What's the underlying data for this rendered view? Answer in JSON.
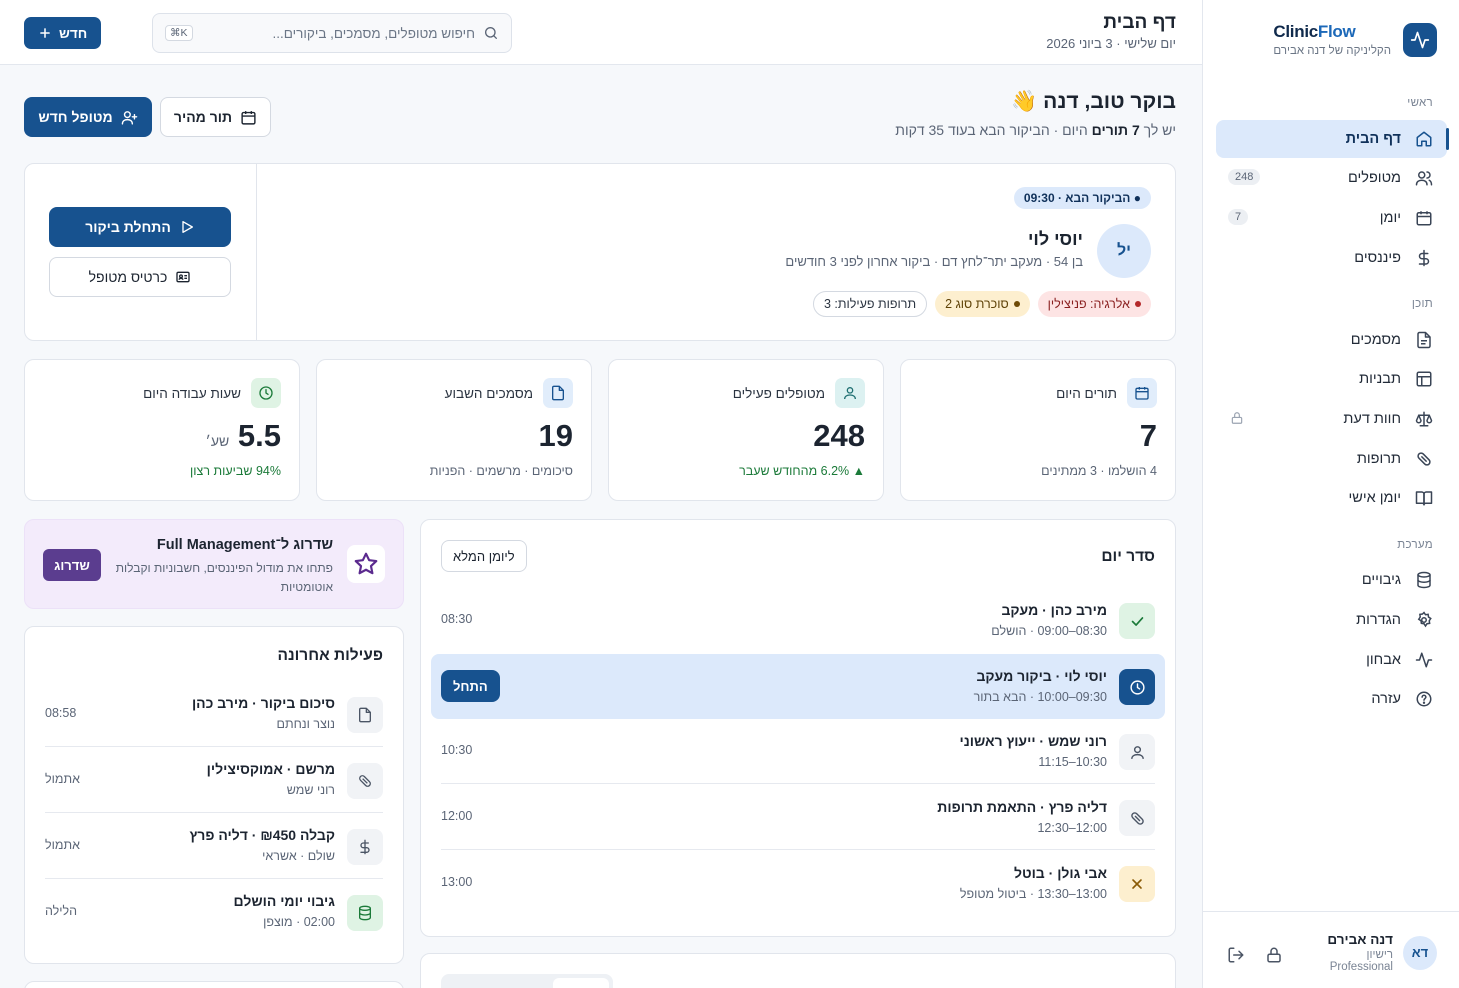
{
  "brand": {
    "name_a": "Clinic",
    "name_b": "Flow",
    "subtitle": "הקליניקה של דנה אבירם"
  },
  "sidebar": {
    "sections": [
      "ראשי",
      "תוכן",
      "מערכת"
    ],
    "items": [
      {
        "label": "דף הבית",
        "icon": "home-icon",
        "active": true
      },
      {
        "label": "מטופלים",
        "icon": "users-icon",
        "count": "248"
      },
      {
        "label": "יומן",
        "icon": "calendar-icon",
        "count": "7"
      },
      {
        "label": "פיננסים",
        "icon": "dollar-icon"
      },
      {
        "label": "מסמכים",
        "icon": "document-icon"
      },
      {
        "label": "תבניות",
        "icon": "template-icon"
      },
      {
        "label": "חוות דעת",
        "icon": "scale-icon",
        "locked": true
      },
      {
        "label": "תרופות",
        "icon": "pill-icon"
      },
      {
        "label": "יומן אישי",
        "icon": "book-icon"
      },
      {
        "label": "גיבויים",
        "icon": "database-icon"
      },
      {
        "label": "הגדרות",
        "icon": "gear-icon"
      },
      {
        "label": "אבחון",
        "icon": "activity-icon"
      },
      {
        "label": "עזרה",
        "icon": "help-icon"
      }
    ]
  },
  "user": {
    "initials": "דא",
    "name": "דנה אבירם",
    "role": "רישיון",
    "plan": "Professional"
  },
  "header": {
    "title": "דף הבית",
    "date": "יום שלישי · 3 ביוני 2026",
    "search_placeholder": "חיפוש מטופלים, מסמכים, ביקורים...",
    "search_kbd": "⌘K",
    "new_label": "חדש"
  },
  "greeting": {
    "title": "בוקר טוב, דנה 👋",
    "sub_a": "יש לך ",
    "sub_bold": "7 תורים",
    "sub_b": " היום · הביקור הבא בעוד 35 דקות",
    "new_patient": "מטופל חדש",
    "quick_appointment": "תור מהיר"
  },
  "next_patient": {
    "badge": "הביקור הבא · 09:30",
    "initials": "יל",
    "name": "יוסי לוי",
    "info": "בן 54 · מעקב יתר־לחץ דם · ביקור אחרון לפני 3 חודשים",
    "tags": [
      "אלרגיה: פניצילין",
      "סוכרת סוג 2",
      "תרופות פעילות: 3"
    ],
    "start_visit": "התחלת ביקור",
    "patient_file": "כרטיס מטופל"
  },
  "stats": [
    {
      "label": "תורים היום",
      "value": "7",
      "unit": "",
      "foot": "4 הושלמו · 3 ממתינים",
      "icon": "calendar-icon",
      "color": "#e1edfb",
      "ink": "#17528f"
    },
    {
      "label": "מטופלים פעילים",
      "value": "248",
      "unit": "",
      "foot": "▲ 6.2% מהחודש שעבר",
      "icon": "user-icon",
      "color": "#dcf1f1",
      "ink": "#1d6e70"
    },
    {
      "label": "מסמכים השבוע",
      "value": "19",
      "unit": "",
      "foot": "סיכומים · מרשמים · הפניות",
      "icon": "document-icon",
      "color": "#e1edfb",
      "ink": "#17528f"
    },
    {
      "label": "שעות עבודה היום",
      "value": "5.5",
      "unit": "שע׳",
      "foot": "94% שביעות רצון",
      "icon": "clock-icon",
      "color": "#dff3e4",
      "ink": "#1b7a39"
    }
  ],
  "upgrade": {
    "title": "שדרוג ל־Full Management",
    "desc": "פתחו את מודול הפיננסים, חשבוניות וקבלות אוטומטיות",
    "button": "שדרוג"
  },
  "schedule": {
    "title": "סדר יום",
    "full_button": "ליומן המלא",
    "start_label": "התחל",
    "rows": [
      {
        "main": "מירב כהן · מעקב",
        "sub": "08:30–09:00 · הושלם",
        "time": "08:30",
        "icon": "check-icon"
      },
      {
        "main": "יוסי לוי · ביקור מעקב",
        "sub": "09:30–10:00 · הבא בתור",
        "time": "",
        "icon": "clock-icon"
      },
      {
        "main": "רוני שמש · ייעוץ ראשוני",
        "sub": "10:30–11:15",
        "time": "10:30",
        "icon": "user-icon"
      },
      {
        "main": "דליה פרץ · התאמת תרופות",
        "sub": "12:00–12:30",
        "time": "12:00",
        "icon": "pill-icon"
      },
      {
        "main": "אבי גולן · בוטל",
        "sub": "13:00–13:30 · ביטול מטופל",
        "time": "13:00",
        "icon": "x-icon"
      }
    ]
  },
  "activity": {
    "title": "פעילות אחרונה",
    "rows": [
      {
        "main": "סיכום ביקור · מירב כהן",
        "sub": "נוצר ונחתם",
        "time": "08:58",
        "icon": "document-icon"
      },
      {
        "main": "מרשם · אמוקסיצילין",
        "sub": "רוני שמש",
        "time": "אתמול",
        "icon": "pill-icon"
      },
      {
        "main": "קבלה ₪450 · דליה פרץ",
        "sub": "שולם · אשראי",
        "time": "אתמול",
        "icon": "dollar-icon"
      },
      {
        "main": "גיבוי יומי הושלם",
        "sub": "02:00 · מוצפן",
        "time": "הלילה",
        "icon": "database-icon"
      }
    ]
  }
}
